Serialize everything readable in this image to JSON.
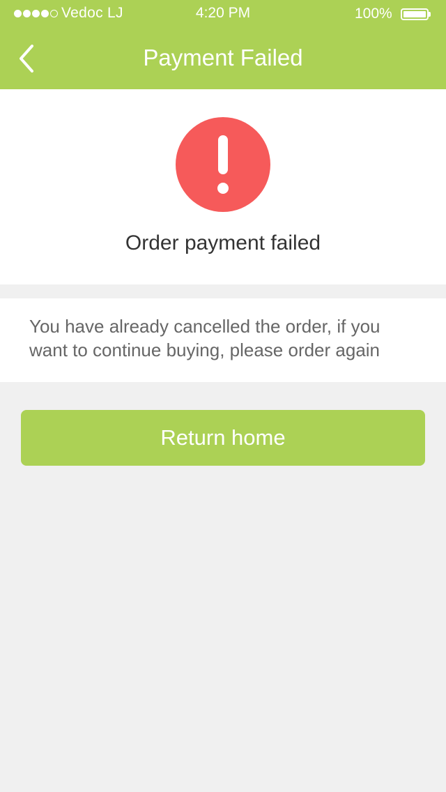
{
  "status_bar": {
    "carrier": "Vedoc LJ",
    "time": "4:20 PM",
    "battery_percent": "100%",
    "signal_bars_filled": 4,
    "signal_bars_total": 5,
    "battery_level": 1.0
  },
  "nav": {
    "title": "Payment Failed",
    "back_icon": "chevron-left-icon"
  },
  "status": {
    "icon": "exclamation-icon",
    "icon_color": "#f65a5a",
    "text": "Order payment failed"
  },
  "message": {
    "text": "You have already cancelled the order, if you want to continue buying, please order again"
  },
  "actions": {
    "return_home_label": "Return home"
  },
  "colors": {
    "accent": "#acd155",
    "error": "#f65a5a",
    "background": "#f0f0f0"
  }
}
